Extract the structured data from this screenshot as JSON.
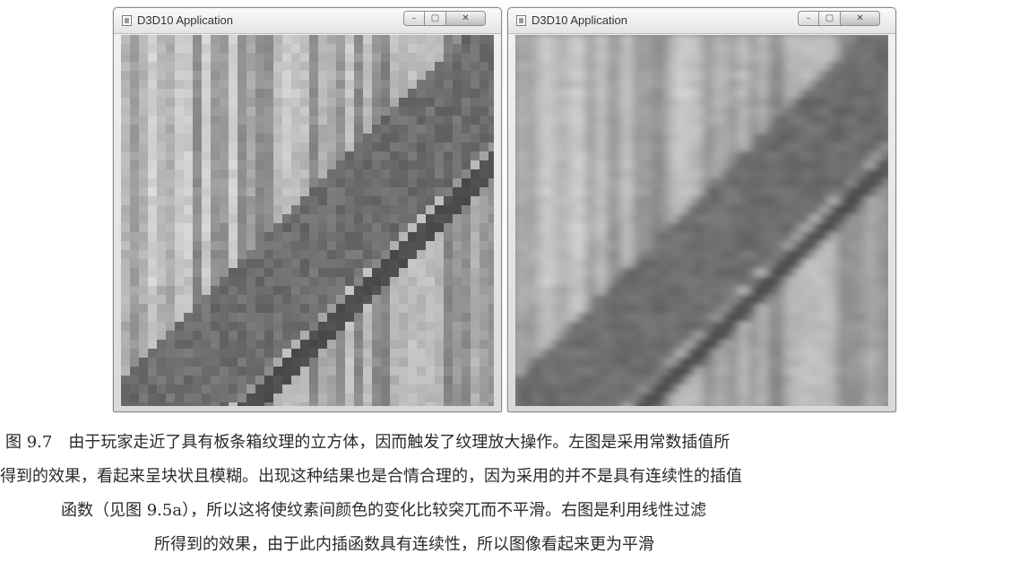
{
  "windows": [
    {
      "title": "D3D10 Application",
      "controls": {
        "minimize": "–",
        "maximize": "▢",
        "close": "✕"
      },
      "texture": "point-sampled wood crate (blocky)"
    },
    {
      "title": "D3D10 Application",
      "controls": {
        "minimize": "–",
        "maximize": "▢",
        "close": "✕"
      },
      "texture": "linear-filtered wood crate (smooth)"
    }
  ],
  "icons": {
    "app": "application-icon",
    "minimize": "minimize-icon",
    "maximize": "maximize-icon",
    "close": "close-icon"
  },
  "caption": {
    "line1": "图 9.7　由于玩家走近了具有板条箱纹理的立方体，因而触发了纹理放大操作。左图是采用常数插值所",
    "line2": "得到的效果，看起来呈块状且模糊。出现这种结果也是合情合理的，因为采用的并不是具有连续性的插值",
    "line3": "函数（见图 9.5a），所以这将使纹素间颜色的变化比较突兀而不平滑。右图是利用线性过滤",
    "line4": "所得到的效果，由于此内插函数具有连续性，所以图像看起来更为平滑"
  }
}
